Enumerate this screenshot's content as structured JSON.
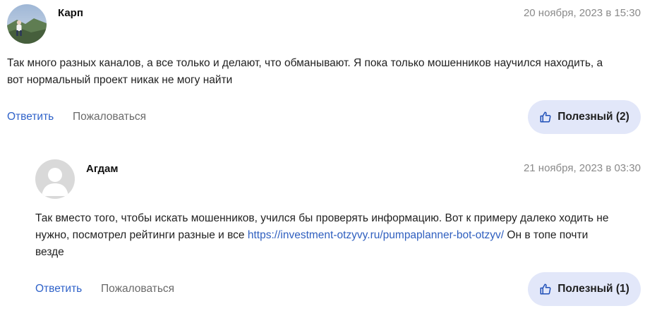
{
  "comments": [
    {
      "author": "Карп",
      "date": "20 ноября, 2023 в 15:30",
      "text_lines": [
        "Так много разных каналов, а все только и делают, что обманывают. Я пока только мошенников научился находить, а",
        "вот нормальный проект никак не могу найти"
      ],
      "reply_label": "Ответить",
      "complain_label": "Пожаловаться",
      "useful_label": "Полезный (2)",
      "avatar": "photo-avatar"
    },
    {
      "author": "Агдам",
      "date": "21 ноября, 2023 в 03:30",
      "text_line1": "Так вместо того, чтобы искать мошенников, учился бы проверять информацию. Вот к примеру далеко ходить не",
      "text_line2_before": "нужно, посмотрел рейтинги разные и все ",
      "link": "https://investment-otzyvy.ru/pumpaplanner-bot-otzyv/",
      "text_line2_after": " Он в топе почти",
      "text_line3": "везде",
      "reply_label": "Ответить",
      "complain_label": "Пожаловаться",
      "useful_label": "Полезный (1)",
      "avatar": "default-avatar"
    }
  ],
  "colors": {
    "link": "#2f62c9",
    "useful_bg": "#e2e7f9",
    "date": "#8a8a8a"
  },
  "icons": {
    "useful": "thumbs-up-icon"
  }
}
